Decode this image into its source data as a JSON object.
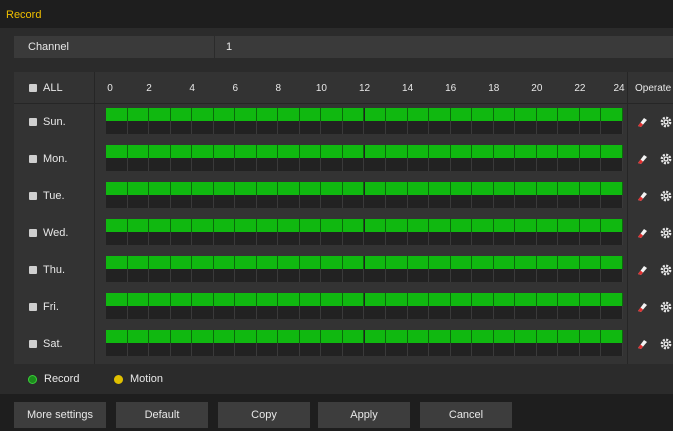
{
  "window": {
    "title": "Record"
  },
  "channel": {
    "label": "Channel",
    "value": "1"
  },
  "schedule": {
    "all_label": "ALL",
    "operate_label": "Operate",
    "hours": [
      "0",
      "2",
      "4",
      "6",
      "8",
      "10",
      "12",
      "14",
      "16",
      "18",
      "20",
      "22",
      "24"
    ],
    "days": [
      {
        "label": "Sun.",
        "record_hours": 24,
        "motion_hours": 0
      },
      {
        "label": "Mon.",
        "record_hours": 24,
        "motion_hours": 0
      },
      {
        "label": "Tue.",
        "record_hours": 24,
        "motion_hours": 0
      },
      {
        "label": "Wed.",
        "record_hours": 24,
        "motion_hours": 0
      },
      {
        "label": "Thu.",
        "record_hours": 24,
        "motion_hours": 0
      },
      {
        "label": "Fri.",
        "record_hours": 24,
        "motion_hours": 0
      },
      {
        "label": "Sat.",
        "record_hours": 24,
        "motion_hours": 0
      }
    ]
  },
  "legend": {
    "record_label": "Record",
    "motion_label": "Motion",
    "record_color": "#10b810",
    "motion_color": "#e0c000"
  },
  "buttons": {
    "more_settings": "More settings",
    "default": "Default",
    "copy": "Copy",
    "apply": "Apply",
    "cancel": "Cancel"
  },
  "icons": {
    "edit": "eraser-icon",
    "settings": "gear-icon",
    "check": "check-circle-icon"
  }
}
